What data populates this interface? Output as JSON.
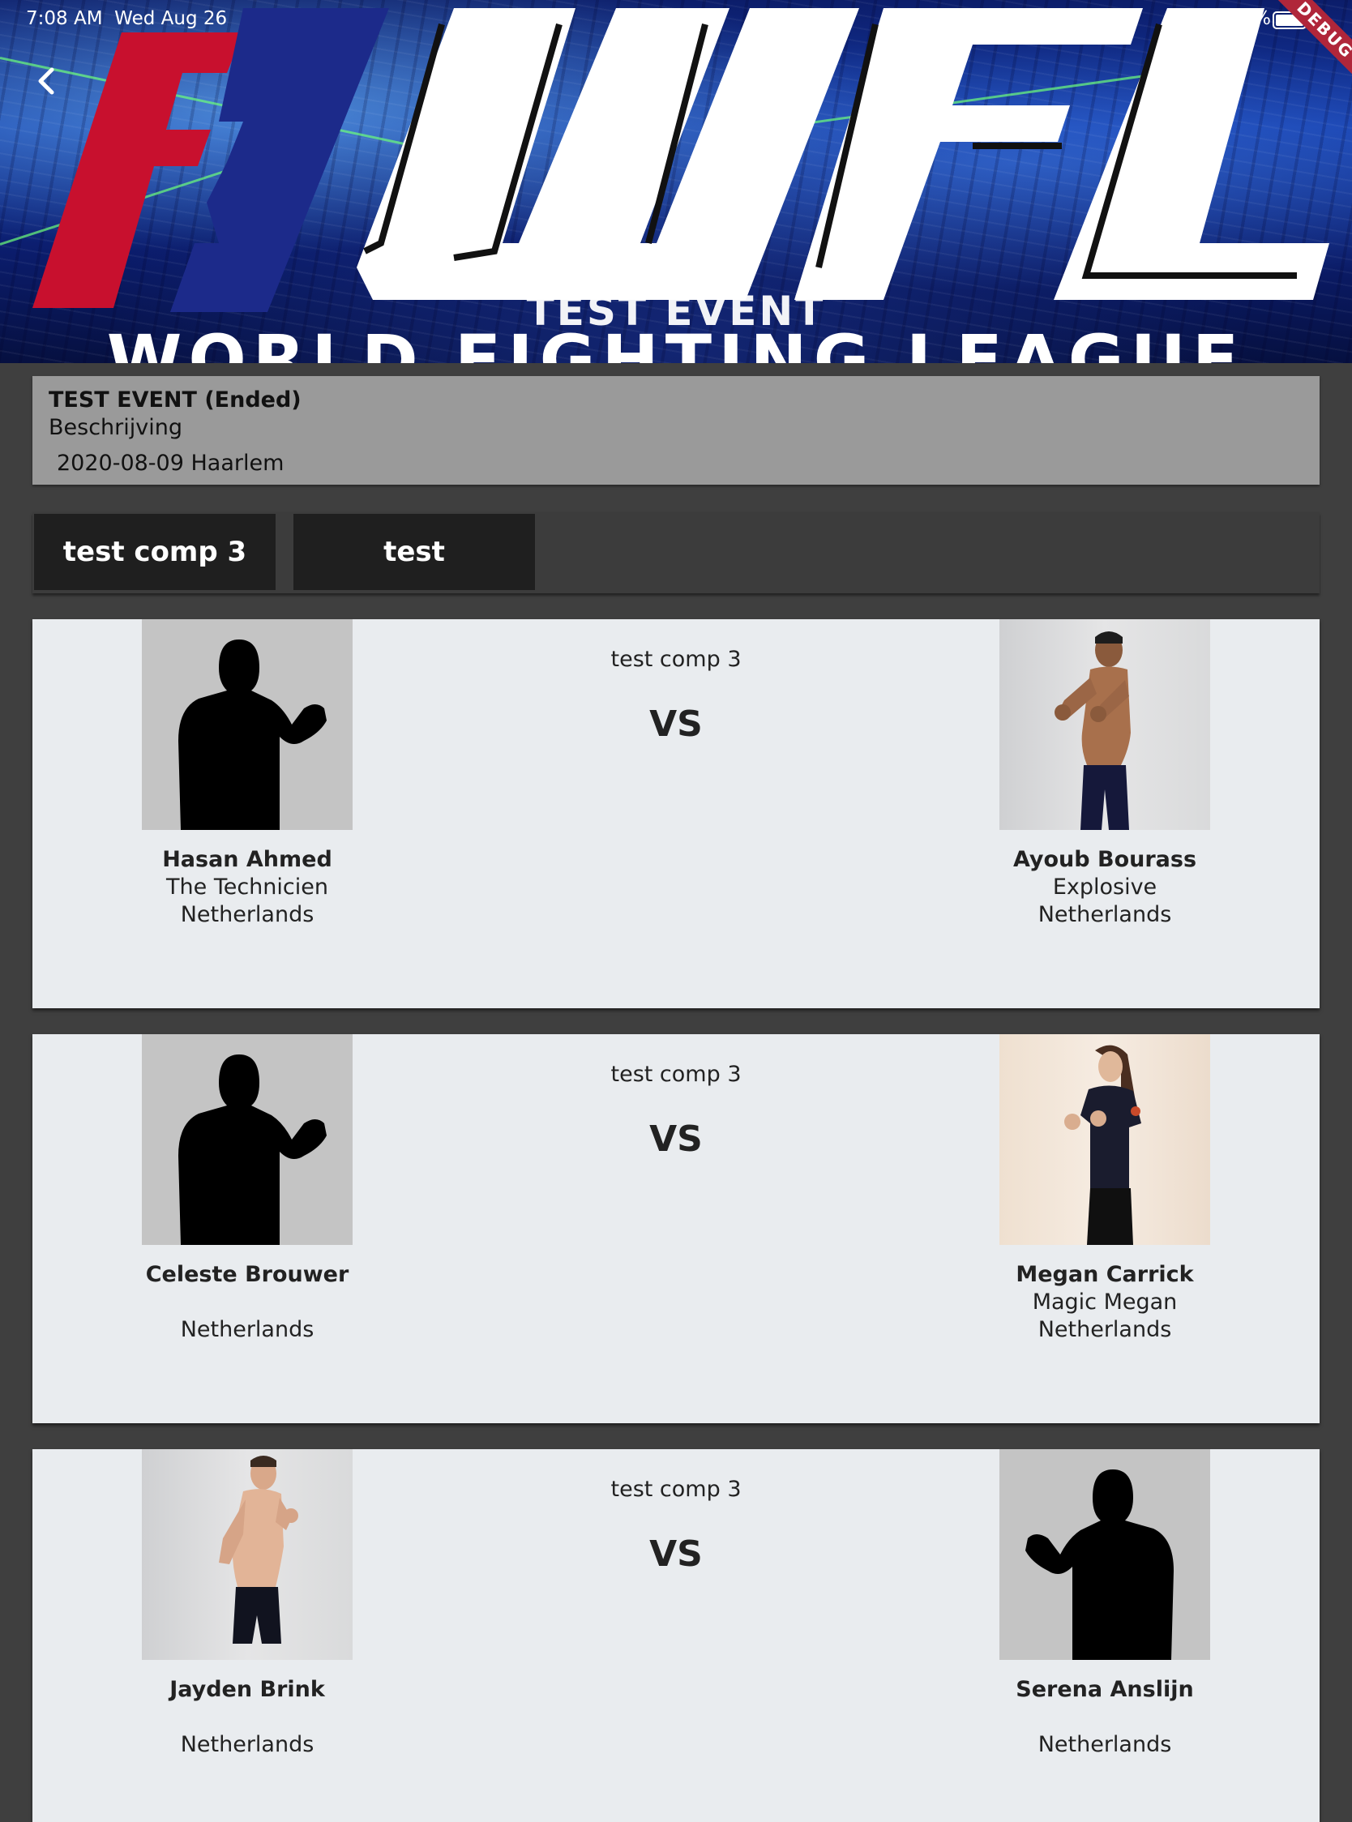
{
  "status_bar": {
    "time": "7:08 AM",
    "date": "Wed Aug 26",
    "battery": "100%",
    "debug_label": "DEBUG"
  },
  "banner": {
    "logo_text": "WFL",
    "event_name_overlay": "TEST EVENT",
    "league_name": "WORLD FIGHTING LEAGUE",
    "colors": {
      "red": "#c8102e",
      "navy": "#1c2a8a",
      "white": "#ffffff"
    }
  },
  "icons": {
    "back": "chevron-left-icon"
  },
  "event": {
    "title": "TEST EVENT (Ended)",
    "description": "Beschrijving",
    "date_location": "2020-08-09 Haarlem"
  },
  "tabs": [
    {
      "label": "test comp 3"
    },
    {
      "label": "test"
    }
  ],
  "fights": [
    {
      "competition": "test comp 3",
      "vs_label": "VS",
      "left": {
        "name": "Hasan Ahmed",
        "nickname": "The Technicien",
        "country": "Netherlands",
        "photo": "silhouette"
      },
      "right": {
        "name": "Ayoub Bourass",
        "nickname": "Explosive",
        "country": "Netherlands",
        "photo": "fighter-photo"
      }
    },
    {
      "competition": "test comp 3",
      "vs_label": "VS",
      "left": {
        "name": "Celeste Brouwer",
        "nickname": "",
        "country": "Netherlands",
        "photo": "silhouette"
      },
      "right": {
        "name": "Megan Carrick",
        "nickname": "Magic Megan",
        "country": "Netherlands",
        "photo": "fighter-photo"
      }
    },
    {
      "competition": "test comp 3",
      "vs_label": "VS",
      "left": {
        "name": "Jayden Brink",
        "nickname": "",
        "country": "Netherlands",
        "photo": "fighter-photo"
      },
      "right": {
        "name": "Serena Anslijn",
        "nickname": "",
        "country": "Netherlands",
        "photo": "silhouette"
      }
    }
  ]
}
